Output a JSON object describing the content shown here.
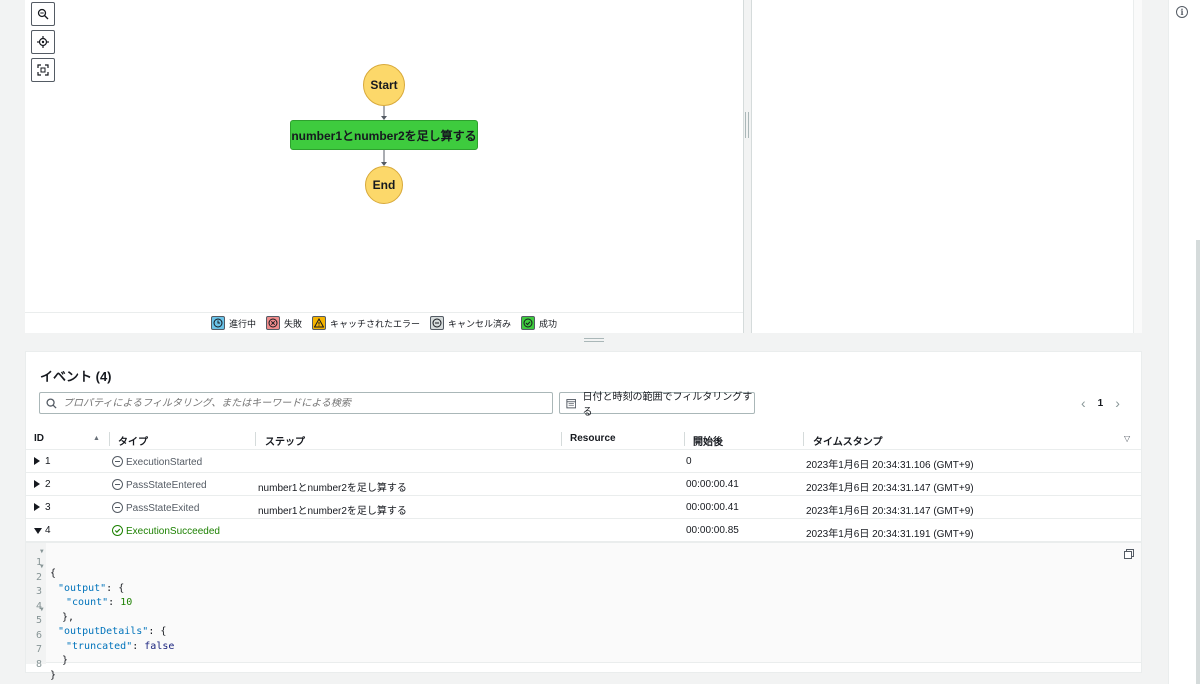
{
  "graph": {
    "start_label": "Start",
    "task_label": "number1とnumber2を足し算する",
    "end_label": "End",
    "legend": [
      {
        "label": "進行中",
        "color": "#6bc3e8"
      },
      {
        "label": "失敗",
        "color": "#f08c8c"
      },
      {
        "label": "キャッチされたエラー",
        "color": "#f5b400"
      },
      {
        "label": "キャンセル済み",
        "color": "#d5dbdb"
      },
      {
        "label": "成功",
        "color": "#3ecb3e"
      }
    ]
  },
  "events": {
    "title": "イベント (4)",
    "search_placeholder": "プロパティによるフィルタリング、またはキーワードによる検索",
    "date_filter_label": "日付と時刻の範囲でフィルタリングする",
    "page": "1",
    "columns": {
      "id": "ID",
      "type": "タイプ",
      "step": "ステップ",
      "resource": "Resource",
      "elapsed": "開始後",
      "timestamp": "タイムスタンプ"
    },
    "rows": [
      {
        "id": "1",
        "type": "ExecutionStarted",
        "step": "",
        "resource": "",
        "elapsed": "0",
        "timestamp": "2023年1月6日 20:34:31.106 (GMT+9)"
      },
      {
        "id": "2",
        "type": "PassStateEntered",
        "step": "number1とnumber2を足し算する",
        "resource": "",
        "elapsed": "00:00:00.41",
        "timestamp": "2023年1月6日 20:34:31.147 (GMT+9)"
      },
      {
        "id": "3",
        "type": "PassStateExited",
        "step": "number1とnumber2を足し算する",
        "resource": "",
        "elapsed": "00:00:00.41",
        "timestamp": "2023年1月6日 20:34:31.147 (GMT+9)"
      },
      {
        "id": "4",
        "type": "ExecutionSucceeded",
        "step": "",
        "resource": "",
        "elapsed": "00:00:00.85",
        "timestamp": "2023年1月6日 20:34:31.191 (GMT+9)"
      }
    ],
    "json_lines": [
      {
        "num": "1",
        "fold": true,
        "text": "{"
      },
      {
        "num": "2",
        "fold": true,
        "key": "\"output\"",
        "rest": ": {"
      },
      {
        "num": "3",
        "fold": false,
        "key": "\"count\"",
        "rest": ": ",
        "num_val": "10"
      },
      {
        "num": "4",
        "fold": false,
        "text": "  },"
      },
      {
        "num": "5",
        "fold": true,
        "key": "\"outputDetails\"",
        "rest": ": {"
      },
      {
        "num": "6",
        "fold": false,
        "key": "\"truncated\"",
        "rest": ": ",
        "bool_val": "false"
      },
      {
        "num": "7",
        "fold": false,
        "text": "  }"
      },
      {
        "num": "8",
        "fold": false,
        "text": "}"
      }
    ]
  }
}
